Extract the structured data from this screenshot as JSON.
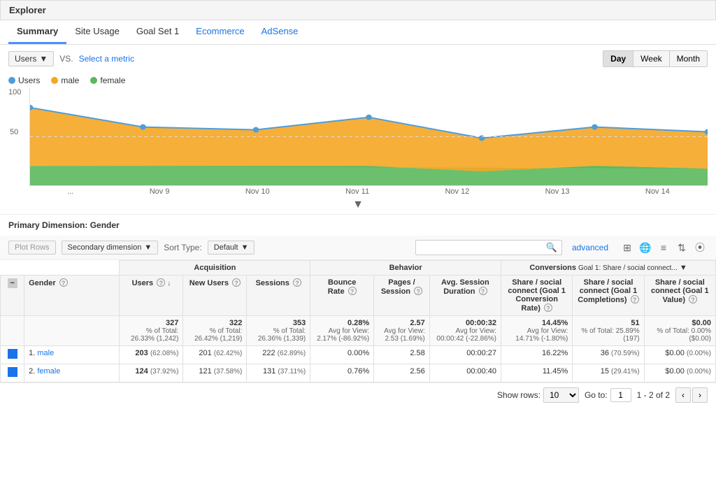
{
  "window": {
    "title": "Explorer"
  },
  "tabs": [
    {
      "id": "summary",
      "label": "Summary",
      "active": true,
      "special": false
    },
    {
      "id": "site-usage",
      "label": "Site Usage",
      "active": false,
      "special": false
    },
    {
      "id": "goal-set-1",
      "label": "Goal Set 1",
      "active": false,
      "special": false
    },
    {
      "id": "ecommerce",
      "label": "Ecommerce",
      "active": false,
      "special": true
    },
    {
      "id": "adsense",
      "label": "AdSense",
      "active": false,
      "special": true
    }
  ],
  "chart_controls": {
    "metric_label": "Users",
    "vs_label": "VS.",
    "select_metric_label": "Select a metric",
    "time_buttons": [
      "Day",
      "Week",
      "Month"
    ],
    "active_time": "Day"
  },
  "legend": [
    {
      "id": "users",
      "label": "Users",
      "color": "#4e9ddb"
    },
    {
      "id": "male",
      "label": "male",
      "color": "#f5a623"
    },
    {
      "id": "female",
      "label": "female",
      "color": "#5cb85c"
    }
  ],
  "chart": {
    "y_label": "100",
    "y_mid_label": "50",
    "x_labels": [
      "Nov 9",
      "Nov 10",
      "Nov 11",
      "Nov 12",
      "Nov 13",
      "Nov 14"
    ]
  },
  "primary_dimension": {
    "label": "Primary Dimension:",
    "value": "Gender"
  },
  "table_controls": {
    "plot_rows_label": "Plot Rows",
    "secondary_dimension_label": "Secondary dimension",
    "sort_type_label": "Sort Type:",
    "default_label": "Default",
    "advanced_label": "advanced",
    "search_placeholder": ""
  },
  "table": {
    "section_headers": {
      "acquisition": "Acquisition",
      "behavior": "Behavior",
      "conversions": "Conversions",
      "conversions_sub": "Goal 1: Share / social connect..."
    },
    "col_headers": {
      "gender": "Gender",
      "users": "Users",
      "new_users": "New Users",
      "sessions": "Sessions",
      "bounce_rate": "Bounce Rate",
      "pages_session": "Pages / Session",
      "avg_session_duration": "Avg. Session Duration",
      "share_social_connect_rate": "Share / social connect (Goal 1 Conversion Rate)",
      "share_social_completions": "Share / social connect (Goal 1 Completions)",
      "share_social_value": "Share / social connect (Goal 1 Value)"
    },
    "totals": {
      "users": "327",
      "users_pct": "% of Total: 26.33% (1,242)",
      "new_users": "322",
      "new_users_pct": "% of Total: 26.42% (1,219)",
      "sessions": "353",
      "sessions_pct": "% of Total: 26.36% (1,339)",
      "bounce_rate": "0.28%",
      "bounce_rate_sub": "Avg for View: 2.17% (-86.92%)",
      "pages_session": "2.57",
      "pages_session_sub": "Avg for View: 2.53 (1.69%)",
      "avg_session": "00:00:32",
      "avg_session_sub": "Avg for View: 00:00:42 (-22.86%)",
      "conversion_rate": "14.45%",
      "conversion_rate_sub": "Avg for View: 14.71% (-1.80%)",
      "completions": "51",
      "completions_pct": "% of Total: 25.89% (197)",
      "value": "$0.00",
      "value_pct": "% of Total: 0.00% ($0.00)"
    },
    "rows": [
      {
        "rank": "1.",
        "gender": "male",
        "users": "203",
        "users_pct": "(62.08%)",
        "new_users": "201",
        "new_users_pct": "(62.42%)",
        "sessions": "222",
        "sessions_pct": "(62.89%)",
        "bounce_rate": "0.00%",
        "pages_session": "2.58",
        "avg_session": "00:00:27",
        "conversion_rate": "16.22%",
        "completions": "36",
        "completions_pct": "(70.59%)",
        "value": "$0.00",
        "value_pct": "(0.00%)",
        "checked": true
      },
      {
        "rank": "2.",
        "gender": "female",
        "users": "124",
        "users_pct": "(37.92%)",
        "new_users": "121",
        "new_users_pct": "(37.58%)",
        "sessions": "131",
        "sessions_pct": "(37.11%)",
        "bounce_rate": "0.76%",
        "pages_session": "2.56",
        "avg_session": "00:00:40",
        "conversion_rate": "11.45%",
        "completions": "15",
        "completions_pct": "(29.41%)",
        "value": "$0.00",
        "value_pct": "(0.00%)",
        "checked": true
      }
    ]
  },
  "footer": {
    "show_rows_label": "Show rows:",
    "show_rows_value": "10",
    "go_to_label": "Go to:",
    "page_value": "1",
    "page_range": "1 - 2 of 2"
  }
}
